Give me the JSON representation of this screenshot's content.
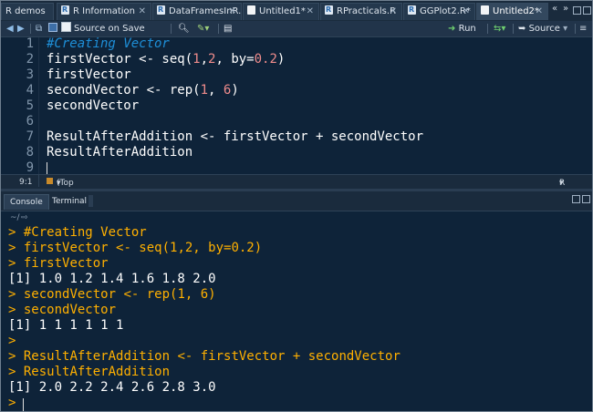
{
  "tabs": [
    {
      "label": "R demos",
      "icon": "file-icon",
      "active": false
    },
    {
      "label": "R Information",
      "icon": "r-file-icon",
      "active": false
    },
    {
      "label": "DataFramesInR.R",
      "icon": "r-file-icon",
      "active": false
    },
    {
      "label": "Untitled1*",
      "icon": "file-icon",
      "active": false
    },
    {
      "label": "RPracticals.R",
      "icon": "r-file-icon",
      "active": false
    },
    {
      "label": "GGPlot2.R*",
      "icon": "r-file-icon",
      "active": false
    },
    {
      "label": "Untitled2*",
      "icon": "file-icon",
      "active": true
    }
  ],
  "toolbar": {
    "source_on_save": "Source on Save",
    "run": "Run",
    "source": "Source"
  },
  "editor": {
    "lines": [
      {
        "n": "1",
        "text": "#Creating Vector"
      },
      {
        "n": "2",
        "text": "firstVector <- seq(1,2, by=0.2)"
      },
      {
        "n": "3",
        "text": "firstVector"
      },
      {
        "n": "4",
        "text": "secondVector <- rep(1, 6)"
      },
      {
        "n": "5",
        "text": "secondVector"
      },
      {
        "n": "6",
        "text": ""
      },
      {
        "n": "7",
        "text": "ResultAfterAddition <- firstVector + secondVector"
      },
      {
        "n": "8",
        "text": "ResultAfterAddition"
      },
      {
        "n": "9",
        "text": ""
      }
    ]
  },
  "status": {
    "position": "9:1",
    "scope": "(Top Level)",
    "filetype": "R Script"
  },
  "console": {
    "tabs": [
      "Console",
      "Terminal"
    ],
    "path": "~/",
    "lines": [
      {
        "prompt": ">",
        "text": "#Creating Vector",
        "kind": "cmd"
      },
      {
        "prompt": ">",
        "text": "firstVector <- seq(1,2, by=0.2)",
        "kind": "cmd"
      },
      {
        "prompt": ">",
        "text": "firstVector",
        "kind": "cmd"
      },
      {
        "prompt": "",
        "text": "[1] 1.0 1.2 1.4 1.6 1.8 2.0",
        "kind": "out"
      },
      {
        "prompt": ">",
        "text": "secondVector <- rep(1, 6)",
        "kind": "cmd"
      },
      {
        "prompt": ">",
        "text": "secondVector",
        "kind": "cmd"
      },
      {
        "prompt": "",
        "text": "[1] 1 1 1 1 1 1",
        "kind": "out"
      },
      {
        "prompt": ">",
        "text": "",
        "kind": "cmd"
      },
      {
        "prompt": ">",
        "text": "ResultAfterAddition <- firstVector + secondVector",
        "kind": "cmd"
      },
      {
        "prompt": ">",
        "text": "ResultAfterAddition",
        "kind": "cmd"
      },
      {
        "prompt": "",
        "text": "[1] 2.0 2.2 2.4 2.6 2.8 3.0",
        "kind": "out"
      },
      {
        "prompt": ">",
        "text": "",
        "kind": "cmd"
      }
    ]
  },
  "colors": {
    "background": "#0e2339",
    "comment": "#1e8fd8",
    "number": "#f08c8c",
    "console_command": "#ffb000",
    "text": "#ffffff"
  }
}
